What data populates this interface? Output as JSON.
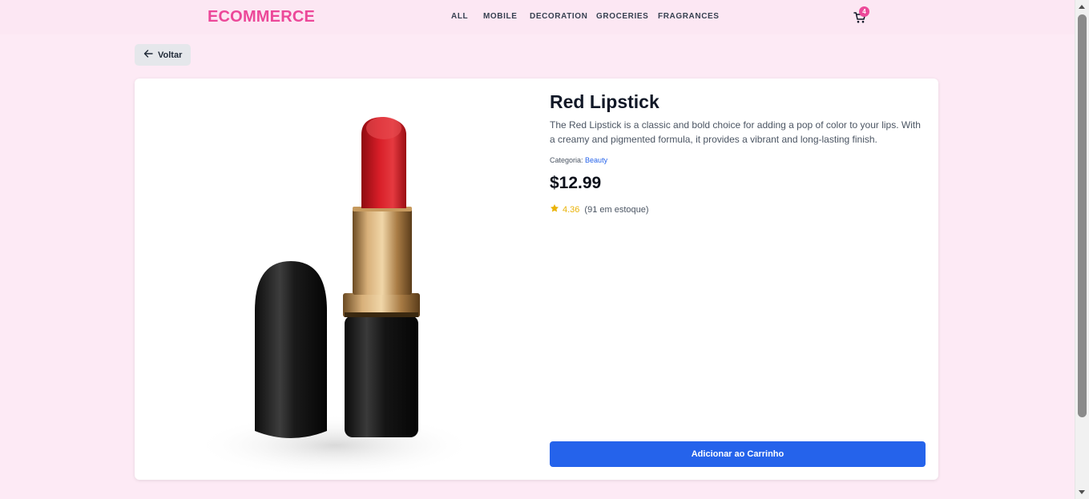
{
  "header": {
    "brand": "ECOMMERCE",
    "nav": [
      "ALL",
      "MOBILE",
      "DECORATION",
      "GROCERIES",
      "FRAGRANCES"
    ],
    "cart_icon": "cart-icon",
    "cart_count": "4"
  },
  "back": {
    "icon": "arrow-left-icon",
    "label": "Voltar"
  },
  "product": {
    "title": "Red Lipstick",
    "description": "The Red Lipstick is a classic and bold choice for adding a pop of color to your lips. With a creamy and pigmented formula, it provides a vibrant and long-lasting finish.",
    "category_label": "Categoria:",
    "category": "Beauty",
    "price": "$12.99",
    "rating_icon": "star-icon",
    "rating": "4.36",
    "stock": "(91 em estoque)",
    "add_to_cart": "Adicionar ao Carrinho"
  },
  "colors": {
    "brand": "#ec4899",
    "primary": "#2563eb",
    "background": "#fdeaf5",
    "header": "#fce7f3",
    "star": "#eab308"
  }
}
